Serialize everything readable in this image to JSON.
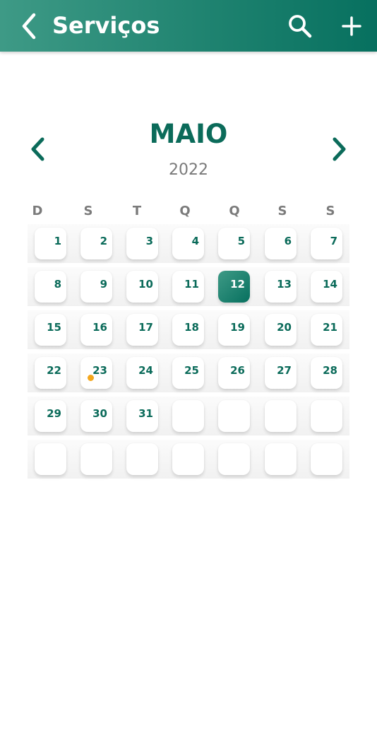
{
  "app_bar": {
    "title": "Serviços",
    "back_icon": "chevron-left-icon",
    "search_icon": "search-icon",
    "add_icon": "plus-icon",
    "gradient": [
      "#3e9a86",
      "#07705f"
    ]
  },
  "calendar": {
    "month": "MAIO",
    "year": "2022",
    "weekdays": [
      "D",
      "S",
      "T",
      "Q",
      "Q",
      "S",
      "S"
    ],
    "selected_day": "12",
    "event_days": [
      "23"
    ],
    "event_color": "#f4a71d",
    "accent_color": "#0b6b5a",
    "weeks": [
      [
        "1",
        "2",
        "3",
        "4",
        "5",
        "6",
        "7"
      ],
      [
        "8",
        "9",
        "10",
        "11",
        "12",
        "13",
        "14"
      ],
      [
        "15",
        "16",
        "17",
        "18",
        "19",
        "20",
        "21"
      ],
      [
        "22",
        "23",
        "24",
        "25",
        "26",
        "27",
        "28"
      ],
      [
        "29",
        "30",
        "31",
        "",
        "",
        "",
        ""
      ],
      [
        "",
        "",
        "",
        "",
        "",
        "",
        ""
      ]
    ]
  }
}
